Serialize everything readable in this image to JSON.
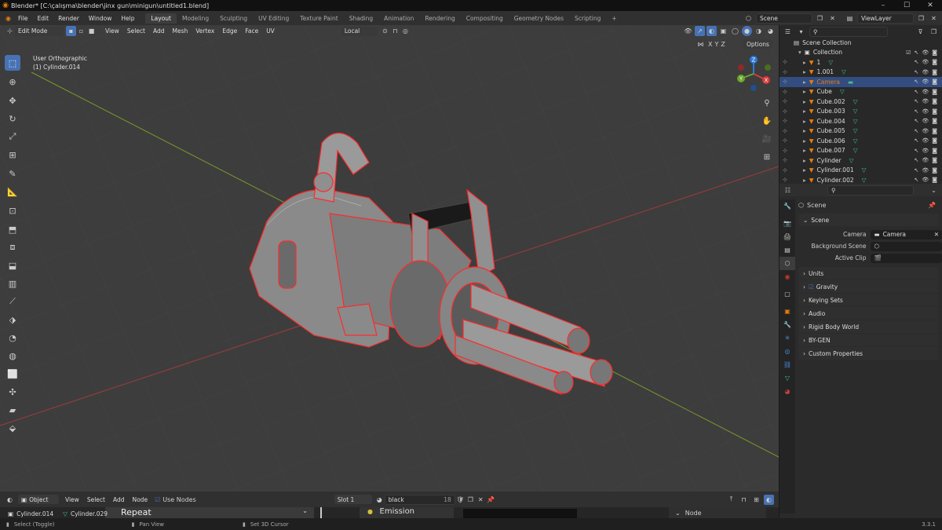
{
  "window": {
    "title": "Blender* [C:\\çalışma\\blender\\jinx gun\\minigun\\untitled1.blend]",
    "controls": [
      "–",
      "☐",
      "✕"
    ]
  },
  "menu": {
    "items": [
      "File",
      "Edit",
      "Render",
      "Window",
      "Help"
    ],
    "workspaces": [
      "Layout",
      "Modeling",
      "Sculpting",
      "UV Editing",
      "Texture Paint",
      "Shading",
      "Animation",
      "Rendering",
      "Compositing",
      "Geometry Nodes",
      "Scripting"
    ],
    "active_workspace": "Layout",
    "add_tab": "+",
    "scene": "Scene",
    "view_layer": "ViewLayer"
  },
  "viewport_header": {
    "mode": "Edit Mode",
    "menus": [
      "View",
      "Select",
      "Add",
      "Mesh",
      "Vertex",
      "Edge",
      "Face",
      "UV"
    ],
    "transform_orientation": "Local",
    "axes": [
      "X",
      "Y",
      "Z"
    ],
    "options": "Options"
  },
  "viewport": {
    "view_name": "User Orthographic",
    "object_name": "(1) Cylinder.014",
    "gizmo": {
      "x": "X",
      "y": "Y",
      "z": "Z"
    }
  },
  "toolbar_icons": [
    "select-box-icon",
    "cursor-icon",
    "move-icon",
    "rotate-icon",
    "scale-icon",
    "transform-icon",
    "annotate-icon",
    "measure-icon",
    "add-cube-icon",
    "extrude-icon",
    "inset-icon",
    "bevel-icon",
    "loop-cut-icon",
    "knife-icon",
    "poly-build-icon",
    "spin-icon",
    "smooth-icon",
    "edge-slide-icon",
    "shrink-icon",
    "shear-icon",
    "rip-icon"
  ],
  "outliner": {
    "search_placeholder": "",
    "root": "Scene Collection",
    "collection": "Collection",
    "items": [
      {
        "name": "1",
        "selected": false
      },
      {
        "name": "1.001",
        "selected": false
      },
      {
        "name": "Camera",
        "selected": true
      },
      {
        "name": "Cube",
        "selected": false
      },
      {
        "name": "Cube.002",
        "selected": false
      },
      {
        "name": "Cube.003",
        "selected": false
      },
      {
        "name": "Cube.004",
        "selected": false
      },
      {
        "name": "Cube.005",
        "selected": false
      },
      {
        "name": "Cube.006",
        "selected": false
      },
      {
        "name": "Cube.007",
        "selected": false
      },
      {
        "name": "Cylinder",
        "selected": false
      },
      {
        "name": "Cylinder.001",
        "selected": false
      },
      {
        "name": "Cylinder.002",
        "selected": false
      }
    ]
  },
  "properties": {
    "breadcrumb": "Scene",
    "panel_scene": "Scene",
    "camera_label": "Camera",
    "camera_value": "Camera",
    "background_scene_label": "Background Scene",
    "active_clip_label": "Active Clip",
    "collapsed_panels": [
      "Units",
      "Gravity",
      "Keying Sets",
      "Audio",
      "Rigid Body World",
      "BY-GEN",
      "Custom Properties"
    ],
    "gravity_checked": true
  },
  "node_editor": {
    "object_mode": "Object",
    "menus": [
      "View",
      "Select",
      "Add",
      "Node"
    ],
    "use_nodes": "Use Nodes",
    "slot": "Slot 1",
    "material": "black",
    "user_count": "18",
    "node_panel": "Node",
    "node_repeat": "Repeat",
    "node_emission": "Emission"
  },
  "status_bar": {
    "obj1": "Cylinder.014",
    "obj2": "Cylinder.029",
    "hint_select": "Select (Toggle)",
    "hint_pan": "Pan View",
    "hint_cursor": "Set 3D Cursor",
    "version": "3.3.1"
  },
  "colors": {
    "accent": "#4772b3",
    "selected_row": "#334d80",
    "wire_red": "#ff2a2a",
    "axis_x": "#a33a3a",
    "axis_y": "#7a9a2a",
    "orange": "#e87d0d",
    "green_icon": "#3fbf8f"
  }
}
